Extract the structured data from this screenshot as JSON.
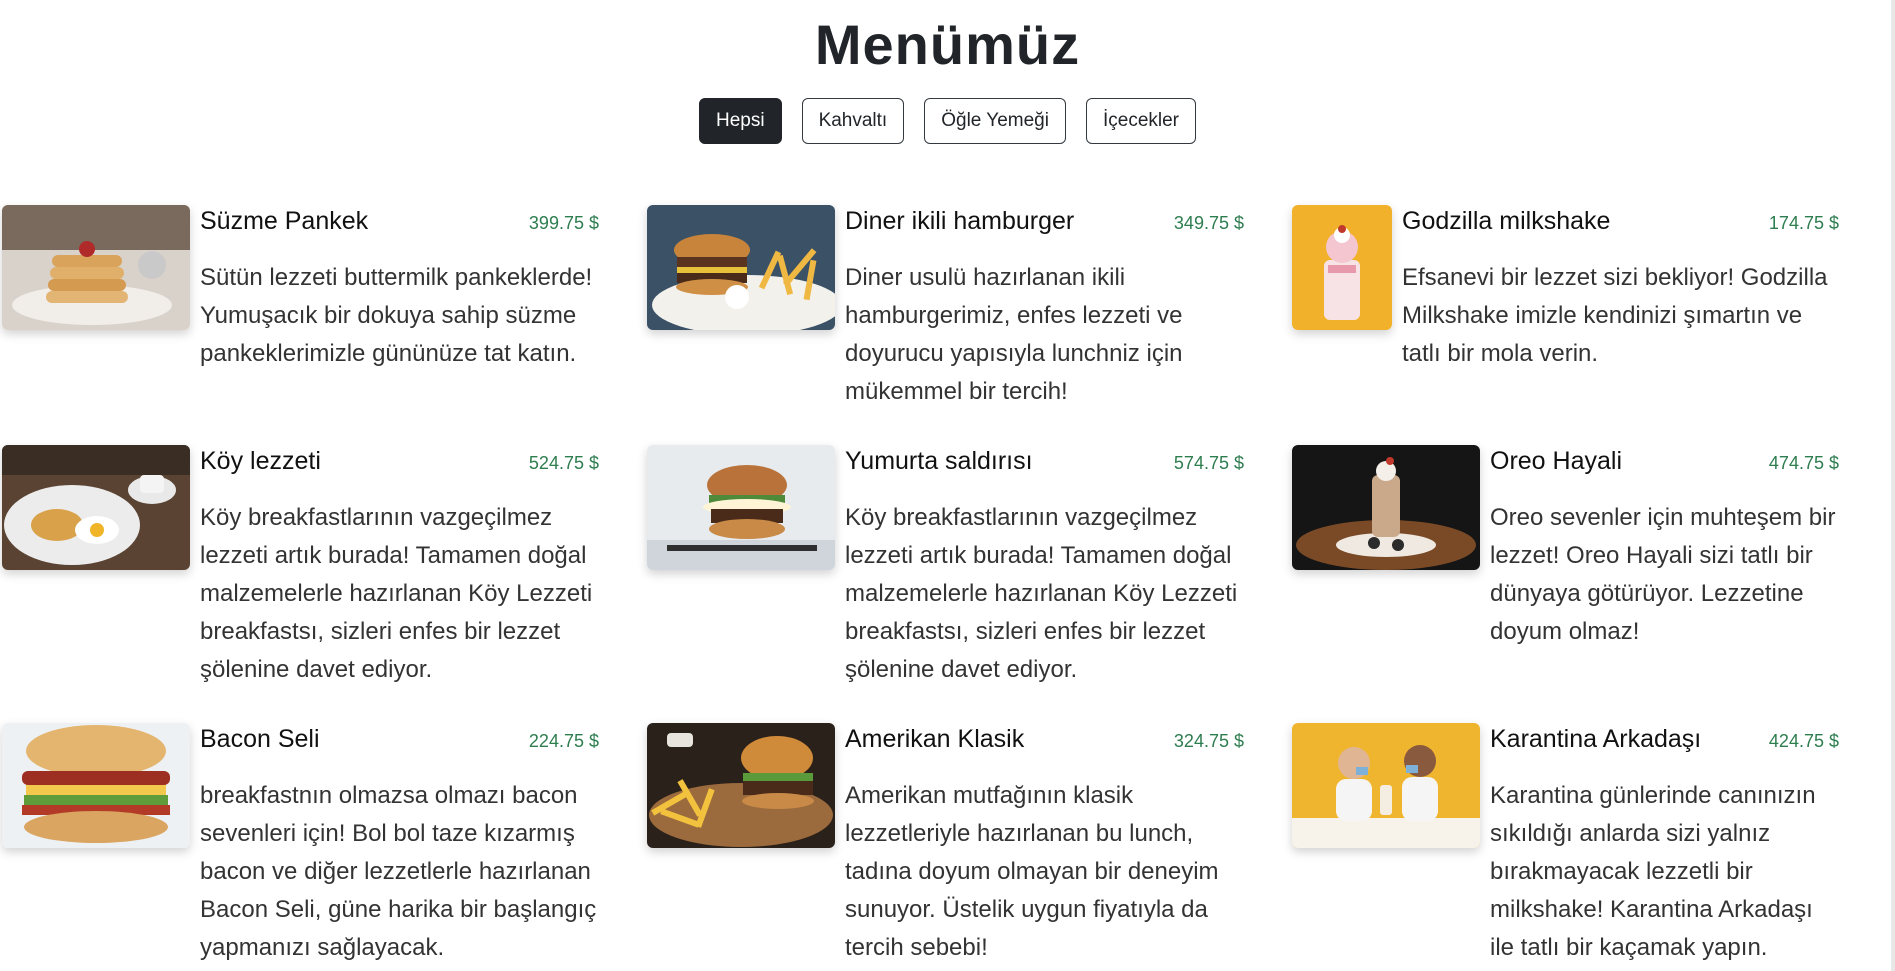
{
  "page": {
    "title": "Menümüz"
  },
  "filters": [
    {
      "label": "Hepsi",
      "active": true
    },
    {
      "label": "Kahvaltı",
      "active": false
    },
    {
      "label": "Öğle Yemeği",
      "active": false
    },
    {
      "label": "İçecekler",
      "active": false
    }
  ],
  "items": [
    {
      "name": "Süzme Pankek",
      "price": "399.75 $",
      "desc": "Sütün lezzeti buttermilk pankeklerde! Yumuşacık bir dokuya sahip süzme pankeklerimizle gününüze tat katın.",
      "image": "pancake-photo"
    },
    {
      "name": "Diner ikili hamburger",
      "price": "349.75 $",
      "desc": "Diner usulü hazırlanan ikili hamburgerimiz, enfes lezzeti ve doyurucu yapısıyla lunchniz için mükemmel bir tercih!",
      "image": "burger-fries-photo"
    },
    {
      "name": "Godzilla milkshake",
      "price": "174.75 $",
      "desc": "Efsanevi bir lezzet sizi bekliyor! Godzilla Milkshake imizle kendinizi şımartın ve tatlı bir mola verin.",
      "image": "milkshake-yellow-photo"
    },
    {
      "name": "Köy lezzeti",
      "price": "524.75 $",
      "desc": "Köy breakfastlarının vazgeçilmez lezzeti artık burada! Tamamen doğal malzemelerle hazırlanan Köy Lezzeti breakfastsı, sizleri enfes bir lezzet şölenine davet ediyor.",
      "image": "breakfast-plate-photo"
    },
    {
      "name": "Yumurta saldırısı",
      "price": "574.75 $",
      "desc": "Köy breakfastlarının vazgeçilmez lezzeti artık burada! Tamamen doğal malzemelerle hazırlanan Köy Lezzeti breakfastsı, sizleri enfes bir lezzet şölenine davet ediyor.",
      "image": "egg-burger-photo"
    },
    {
      "name": "Oreo Hayali",
      "price": "474.75 $",
      "desc": "Oreo sevenler için muhteşem bir lezzet! Oreo Hayali sizi tatlı bir dünyaya götürüyor. Lezzetine doyum olmaz!",
      "image": "oreo-shake-photo"
    },
    {
      "name": "Bacon Seli",
      "price": "224.75 $",
      "desc": "breakfastnın olmazsa olmazı bacon sevenleri için! Bol bol taze kızarmış bacon ve diğer lezzetlerle hazırlanan Bacon Seli, güne harika bir başlangıç yapmanızı sağlayacak.",
      "image": "bacon-sandwich-photo"
    },
    {
      "name": "Amerikan Klasik",
      "price": "324.75 $",
      "desc": "Amerikan mutfağının klasik lezzetleriyle hazırlanan bu lunch, tadına doyum olmayan bir deneyim sunuyor. Üstelik uygun fiyatıyla da tercih sebebi!",
      "image": "burger-board-photo"
    },
    {
      "name": "Karantina Arkadaşı",
      "price": "424.75 $",
      "desc": "Karantina günlerinde canınızın sıkıldığı anlarda sizi yalnız bırakmayacak lezzetli bir milkshake! Karantina Arkadaşı ile tatlı bir kaçamak yapın.",
      "image": "couple-milkshake-photo"
    }
  ]
}
